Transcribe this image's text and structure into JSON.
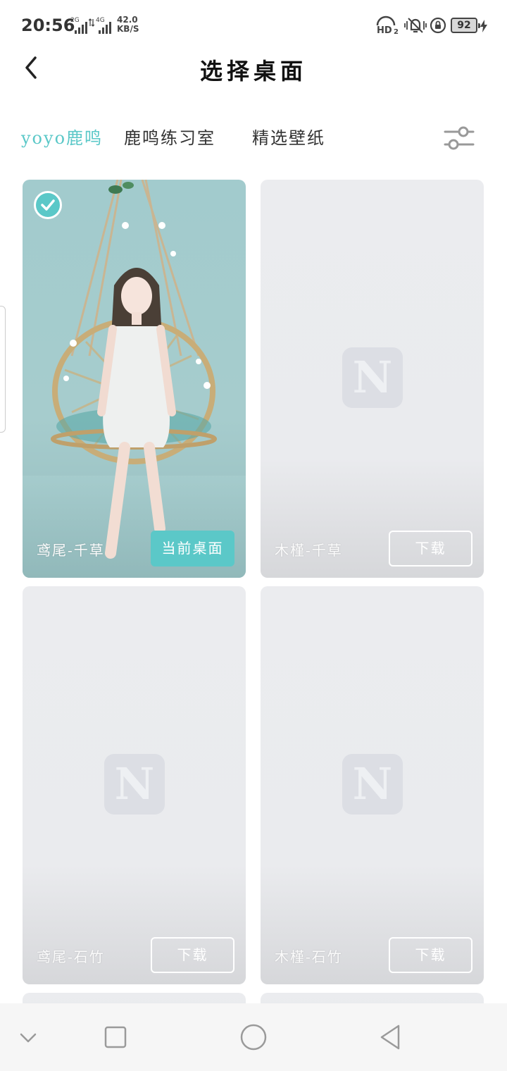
{
  "status_bar": {
    "time": "20:56",
    "sim1_tag": "2G",
    "sim2_tag": "4G",
    "net_speed_value": "42.0",
    "net_speed_unit": "KB/S",
    "hd_label": "HD",
    "hd_sub": "2",
    "battery": "92"
  },
  "header": {
    "title": "选择桌面"
  },
  "tabs": [
    {
      "label": "yoyo鹿鸣"
    },
    {
      "label": "鹿鸣练习室"
    },
    {
      "label": "精选壁纸"
    }
  ],
  "cards": [
    {
      "name": "鸢尾-千草",
      "button": "当前桌面"
    },
    {
      "name": "木槿-千草",
      "button": "下载"
    },
    {
      "name": "鸢尾-石竹",
      "button": "下载"
    },
    {
      "name": "木槿-石竹",
      "button": "下载"
    }
  ],
  "placeholder_letter": "N",
  "colors": {
    "accent": "#5bc8c8",
    "card_bg": "#ebecef",
    "active_card_bg": "#a2cbcd"
  }
}
